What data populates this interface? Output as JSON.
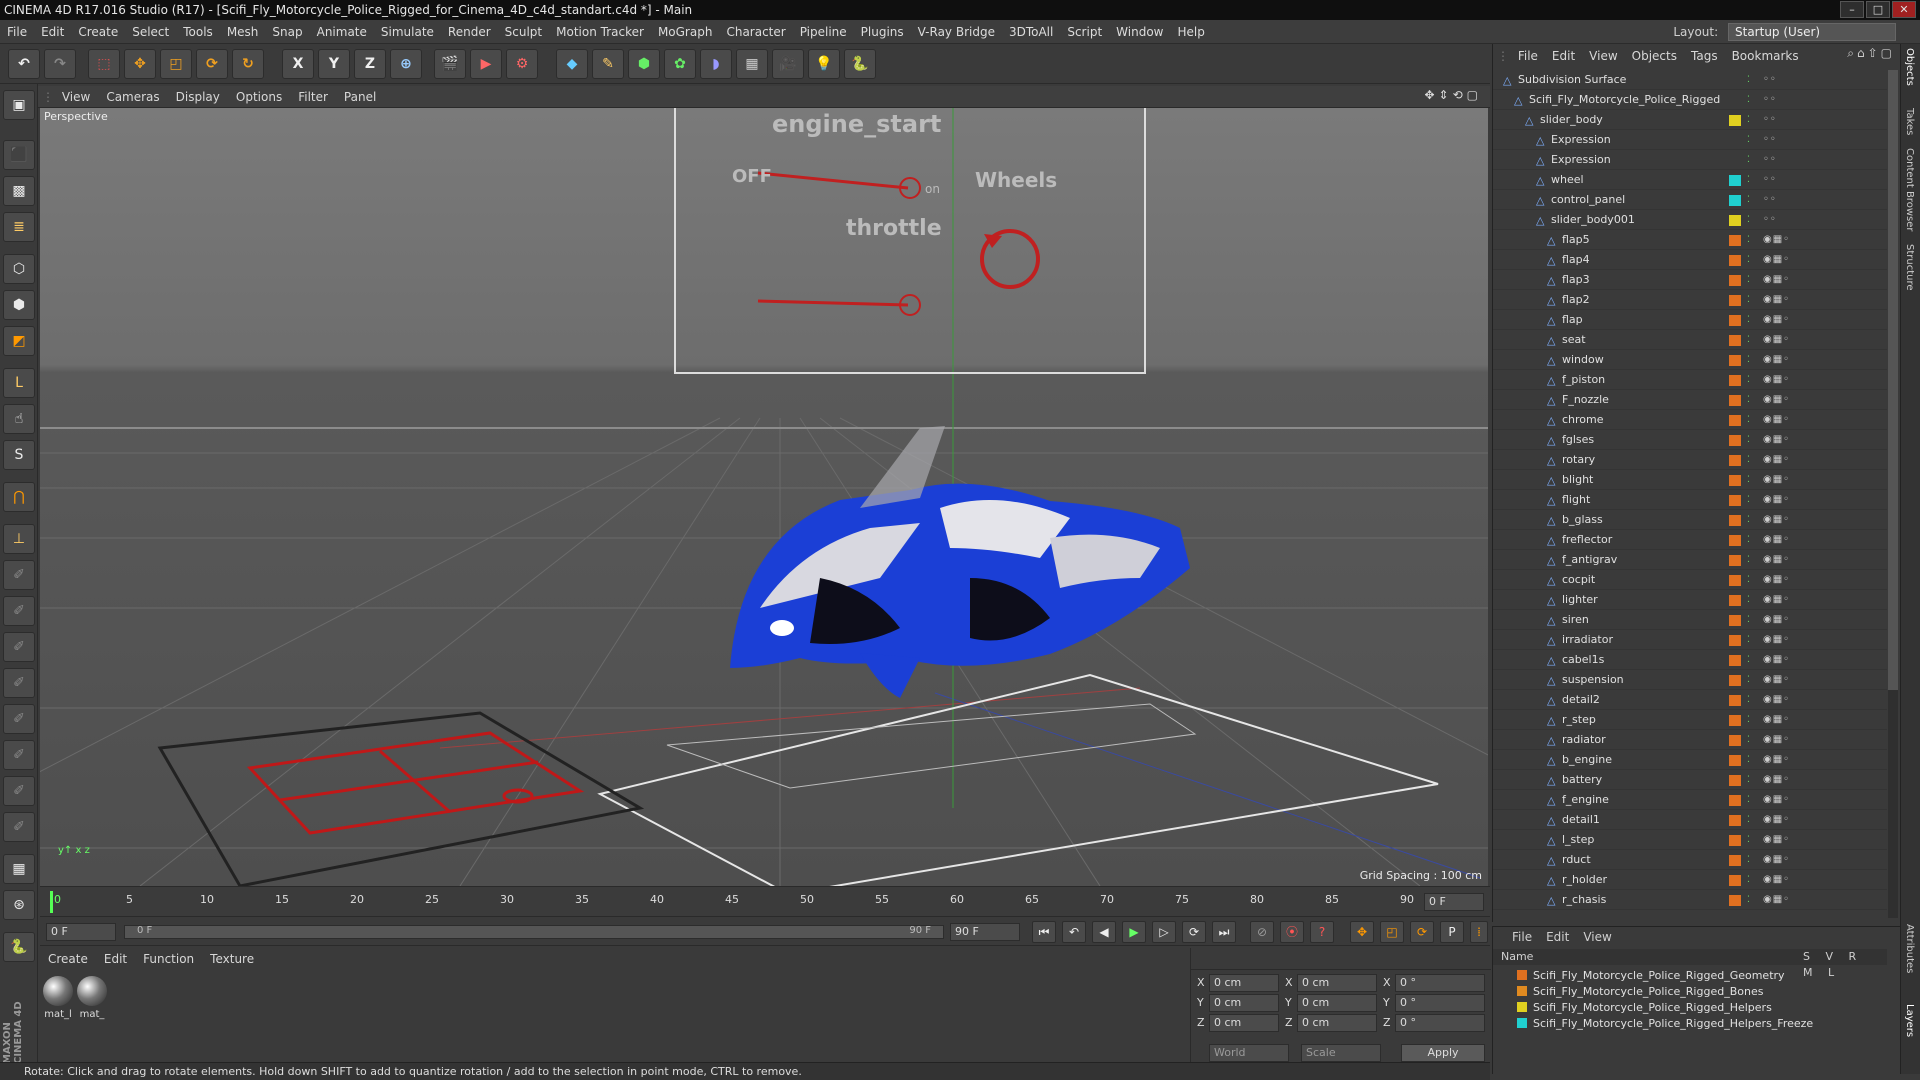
{
  "window": {
    "title": "CINEMA 4D R17.016 Studio (R17) - [Scifi_Fly_Motorcycle_Police_Rigged_for_Cinema_4D_c4d_standart.c4d *] - Main"
  },
  "menu": [
    "File",
    "Edit",
    "Create",
    "Select",
    "Tools",
    "Mesh",
    "Snap",
    "Animate",
    "Simulate",
    "Render",
    "Sculpt",
    "Motion Tracker",
    "MoGraph",
    "Character",
    "Pipeline",
    "Plugins",
    "V-Ray Bridge",
    "3DToAll",
    "Script",
    "Window",
    "Help"
  ],
  "layout": {
    "label": "Layout:",
    "value": "Startup (User)"
  },
  "toolbar": {
    "x": "X",
    "y": "Y",
    "z": "Z"
  },
  "left_tools": {
    "l": "L",
    "s": "S"
  },
  "viewport": {
    "menu": [
      "View",
      "Cameras",
      "Display",
      "Options",
      "Filter",
      "Panel"
    ],
    "label": "Perspective",
    "grid_spacing": "Grid Spacing : 100 cm",
    "panel": {
      "engine": "engine_start",
      "off": "OFF",
      "on": "on",
      "wheels": "Wheels",
      "throttle": "throttle"
    }
  },
  "timeline": {
    "ticks": [
      "0",
      "5",
      "10",
      "15",
      "20",
      "25",
      "30",
      "35",
      "40",
      "45",
      "50",
      "55",
      "60",
      "65",
      "70",
      "75",
      "80",
      "85",
      "90"
    ],
    "frame_right": "0 F"
  },
  "transport": {
    "start": "0 F",
    "current": "0 F",
    "end_inner": "90 F",
    "end": "90 F"
  },
  "material_manager": {
    "menu": [
      "Create",
      "Edit",
      "Function",
      "Texture"
    ],
    "materials": [
      "mat_l",
      "mat_"
    ]
  },
  "coordinates": {
    "rows": [
      {
        "axis": "X",
        "pos": "0 cm",
        "size_axis": "X",
        "size": "0 cm",
        "rot_axis": "X",
        "rot": "0 °"
      },
      {
        "axis": "Y",
        "pos": "0 cm",
        "size_axis": "Y",
        "size": "0 cm",
        "rot_axis": "Y",
        "rot": "0 °"
      },
      {
        "axis": "Z",
        "pos": "0 cm",
        "size_axis": "Z",
        "size": "0 cm",
        "rot_axis": "Z",
        "rot": "0 °"
      }
    ],
    "mode": "World",
    "type": "Scale",
    "apply": "Apply"
  },
  "object_manager": {
    "menu": [
      "File",
      "Edit",
      "View",
      "Objects",
      "Tags",
      "Bookmarks"
    ],
    "objects": [
      {
        "name": "Subdivision Surface",
        "indent": 0,
        "color": ""
      },
      {
        "name": "Scifi_Fly_Motorcycle_Police_Rigged",
        "indent": 1,
        "color": ""
      },
      {
        "name": "slider_body",
        "indent": 2,
        "color": "#e0d020"
      },
      {
        "name": "Expression",
        "indent": 3,
        "color": ""
      },
      {
        "name": "Expression",
        "indent": 3,
        "color": ""
      },
      {
        "name": "wheel",
        "indent": 3,
        "color": "#20d0d0"
      },
      {
        "name": "control_panel",
        "indent": 3,
        "color": "#20d0d0"
      },
      {
        "name": "slider_body001",
        "indent": 3,
        "color": "#e0d020"
      },
      {
        "name": "flap5",
        "indent": 4,
        "color": "#e07020"
      },
      {
        "name": "flap4",
        "indent": 4,
        "color": "#e07020"
      },
      {
        "name": "flap3",
        "indent": 4,
        "color": "#e07020"
      },
      {
        "name": "flap2",
        "indent": 4,
        "color": "#e07020"
      },
      {
        "name": "flap",
        "indent": 4,
        "color": "#e07020"
      },
      {
        "name": "seat",
        "indent": 4,
        "color": "#e07020"
      },
      {
        "name": "window",
        "indent": 4,
        "color": "#e07020"
      },
      {
        "name": "f_piston",
        "indent": 4,
        "color": "#e07020"
      },
      {
        "name": "F_nozzle",
        "indent": 4,
        "color": "#e07020"
      },
      {
        "name": "chrome",
        "indent": 4,
        "color": "#e07020"
      },
      {
        "name": "fglses",
        "indent": 4,
        "color": "#e07020"
      },
      {
        "name": "rotary",
        "indent": 4,
        "color": "#e07020"
      },
      {
        "name": "blight",
        "indent": 4,
        "color": "#e07020"
      },
      {
        "name": "flight",
        "indent": 4,
        "color": "#e07020"
      },
      {
        "name": "b_glass",
        "indent": 4,
        "color": "#e07020"
      },
      {
        "name": "freflector",
        "indent": 4,
        "color": "#e07020"
      },
      {
        "name": "f_antigrav",
        "indent": 4,
        "color": "#e07020"
      },
      {
        "name": "cocpit",
        "indent": 4,
        "color": "#e07020"
      },
      {
        "name": "lighter",
        "indent": 4,
        "color": "#e07020"
      },
      {
        "name": "siren",
        "indent": 4,
        "color": "#e07020"
      },
      {
        "name": "irradiator",
        "indent": 4,
        "color": "#e07020"
      },
      {
        "name": "cabel1s",
        "indent": 4,
        "color": "#e07020"
      },
      {
        "name": "suspension",
        "indent": 4,
        "color": "#e07020"
      },
      {
        "name": "detail2",
        "indent": 4,
        "color": "#e07020"
      },
      {
        "name": "r_step",
        "indent": 4,
        "color": "#e07020"
      },
      {
        "name": "radiator",
        "indent": 4,
        "color": "#e07020"
      },
      {
        "name": "b_engine",
        "indent": 4,
        "color": "#e07020"
      },
      {
        "name": "battery",
        "indent": 4,
        "color": "#e07020"
      },
      {
        "name": "f_engine",
        "indent": 4,
        "color": "#e07020"
      },
      {
        "name": "detail1",
        "indent": 4,
        "color": "#e07020"
      },
      {
        "name": "l_step",
        "indent": 4,
        "color": "#e07020"
      },
      {
        "name": "rduct",
        "indent": 4,
        "color": "#e07020"
      },
      {
        "name": "r_holder",
        "indent": 4,
        "color": "#e07020"
      },
      {
        "name": "r_chasis",
        "indent": 4,
        "color": "#e07020"
      }
    ]
  },
  "layer_manager": {
    "menu": [
      "File",
      "Edit",
      "View"
    ],
    "header": "Name",
    "cols": "S V R M L",
    "layers": [
      {
        "name": "Scifi_Fly_Motorcycle_Police_Rigged_Geometry",
        "color": "#e07020"
      },
      {
        "name": "Scifi_Fly_Motorcycle_Police_Rigged_Bones",
        "color": "#e08a20"
      },
      {
        "name": "Scifi_Fly_Motorcycle_Police_Rigged_Helpers",
        "color": "#e0d020"
      },
      {
        "name": "Scifi_Fly_Motorcycle_Police_Rigged_Helpers_Freeze",
        "color": "#20d0d0"
      }
    ]
  },
  "right_tabs": [
    "Objects",
    "Takes",
    "Content Browser",
    "Structure",
    "Attributes",
    "Layers"
  ],
  "status": "Rotate: Click and drag to rotate elements. Hold down SHIFT to add to quantize rotation / add to the selection in point mode, CTRL to remove."
}
